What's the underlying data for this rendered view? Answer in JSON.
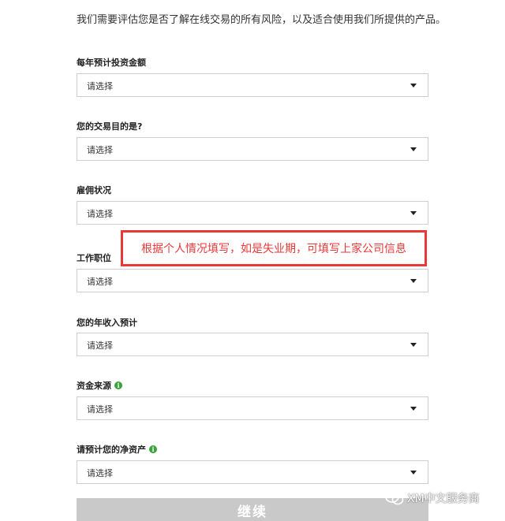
{
  "intro_text": "我们需要评估您是否了解在线交易的所有风险，以及适合使用我们所提供的产品。",
  "fields": [
    {
      "label": "每年预计投资金额",
      "value": "请选择",
      "info": false
    },
    {
      "label": "您的交易目的是?",
      "value": "请选择",
      "info": false
    },
    {
      "label": "雇佣状况",
      "value": "请选择",
      "info": false
    },
    {
      "label": "工作职位",
      "value": "请选择",
      "info": false
    },
    {
      "label": "您的年收入预计",
      "value": "请选择",
      "info": false
    },
    {
      "label": "资金来源",
      "value": "请选择",
      "info": true
    },
    {
      "label": "请预计您的净资产",
      "value": "请选择",
      "info": true
    }
  ],
  "info_icon_glyph": "i",
  "callout_text": "根据个人情况填写，如是失业期，可填写上家公司信息",
  "continue_label": "继续",
  "watermark_text": "XM中文服务商",
  "colors": {
    "callout_red": "#e83838",
    "info_green": "#3aa23a",
    "button_gray": "#c9c9c9"
  }
}
